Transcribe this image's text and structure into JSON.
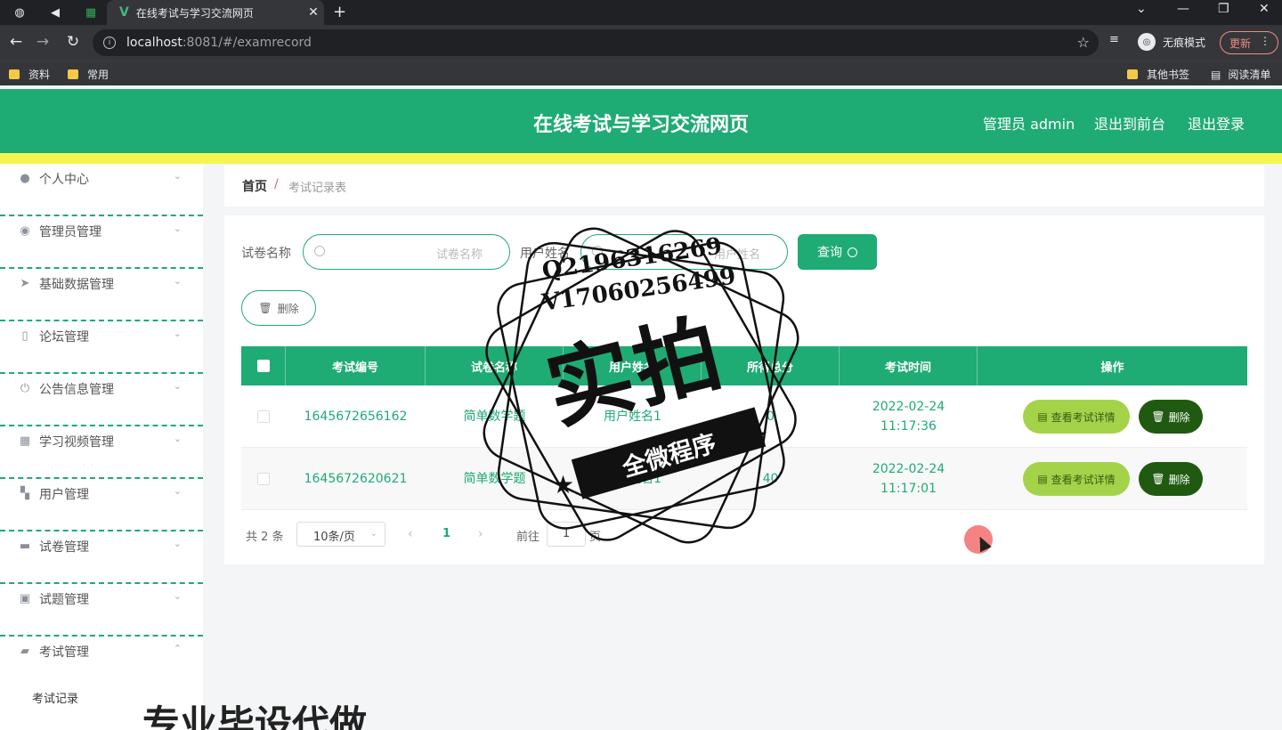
{
  "browser": {
    "tab_title": "在线考试与学习交流网页",
    "tab_logo": "V",
    "url_host": "localhost",
    "url_rest": ":8081/#/examrecord",
    "incognito_label": "无痕模式",
    "update_label": "更新",
    "bookmarks": [
      "资料",
      "常用"
    ],
    "bookmarks_right": [
      "其他书签",
      "阅读清单"
    ]
  },
  "app": {
    "title": "在线考试与学习交流网页",
    "user_label": "管理员 admin",
    "front_link": "退出到前台",
    "logout_link": "退出登录"
  },
  "sidebar": {
    "items": [
      {
        "label": "个人中心",
        "icon": "person-icon"
      },
      {
        "label": "管理员管理",
        "icon": "bulb-icon"
      },
      {
        "label": "基础数据管理",
        "icon": "send-icon"
      },
      {
        "label": "论坛管理",
        "icon": "mic-icon"
      },
      {
        "label": "公告信息管理",
        "icon": "power-icon"
      },
      {
        "label": "学习视频管理",
        "icon": "grid-icon"
      },
      {
        "label": "用户管理",
        "icon": "apps-icon"
      },
      {
        "label": "试卷管理",
        "icon": "briefcase-icon"
      },
      {
        "label": "试题管理",
        "icon": "notebook-icon"
      },
      {
        "label": "考试管理",
        "icon": "ticket-icon"
      }
    ],
    "sub_item": "考试记录"
  },
  "breadcrumb": {
    "home": "首页",
    "sep": "/",
    "current": "考试记录表"
  },
  "search": {
    "paper_label": "试卷名称",
    "paper_placeholder": "试卷名称",
    "user_label": "用户姓名",
    "user_placeholder": "用户姓名",
    "query_button": "查询",
    "delete_button": "删除"
  },
  "table": {
    "headers": [
      "考试编号",
      "试卷名称",
      "用户姓名",
      "所得总分",
      "考试时间",
      "操作"
    ],
    "rows": [
      {
        "id": "1645672656162",
        "paper": "简单数学题",
        "user": "用户姓名1",
        "score": "0",
        "time": "2022-02-24 11:17:36"
      },
      {
        "id": "1645672620621",
        "paper": "简单数学题",
        "user": "用户姓名1",
        "score": "40",
        "time": "2022-02-24 11:17:01"
      }
    ],
    "detail_button": "查看考试详情",
    "row_delete_button": "删除"
  },
  "pagination": {
    "total": "共 2 条",
    "page_size": "10条/页",
    "current_page": "1",
    "goto_label": "前往",
    "goto_value": "1",
    "page_suffix": "页"
  },
  "watermark": {
    "qq": "Q2196316269",
    "v": "V17060256499",
    "main": "实拍",
    "ribbon": "全微程序"
  },
  "bottom_text": "专业毕设代做",
  "colors": {
    "primary": "#1fab74",
    "yellow_strip": "#f5f552",
    "detail_btn": "#a4d34a",
    "delete_btn": "#1f5a10"
  }
}
